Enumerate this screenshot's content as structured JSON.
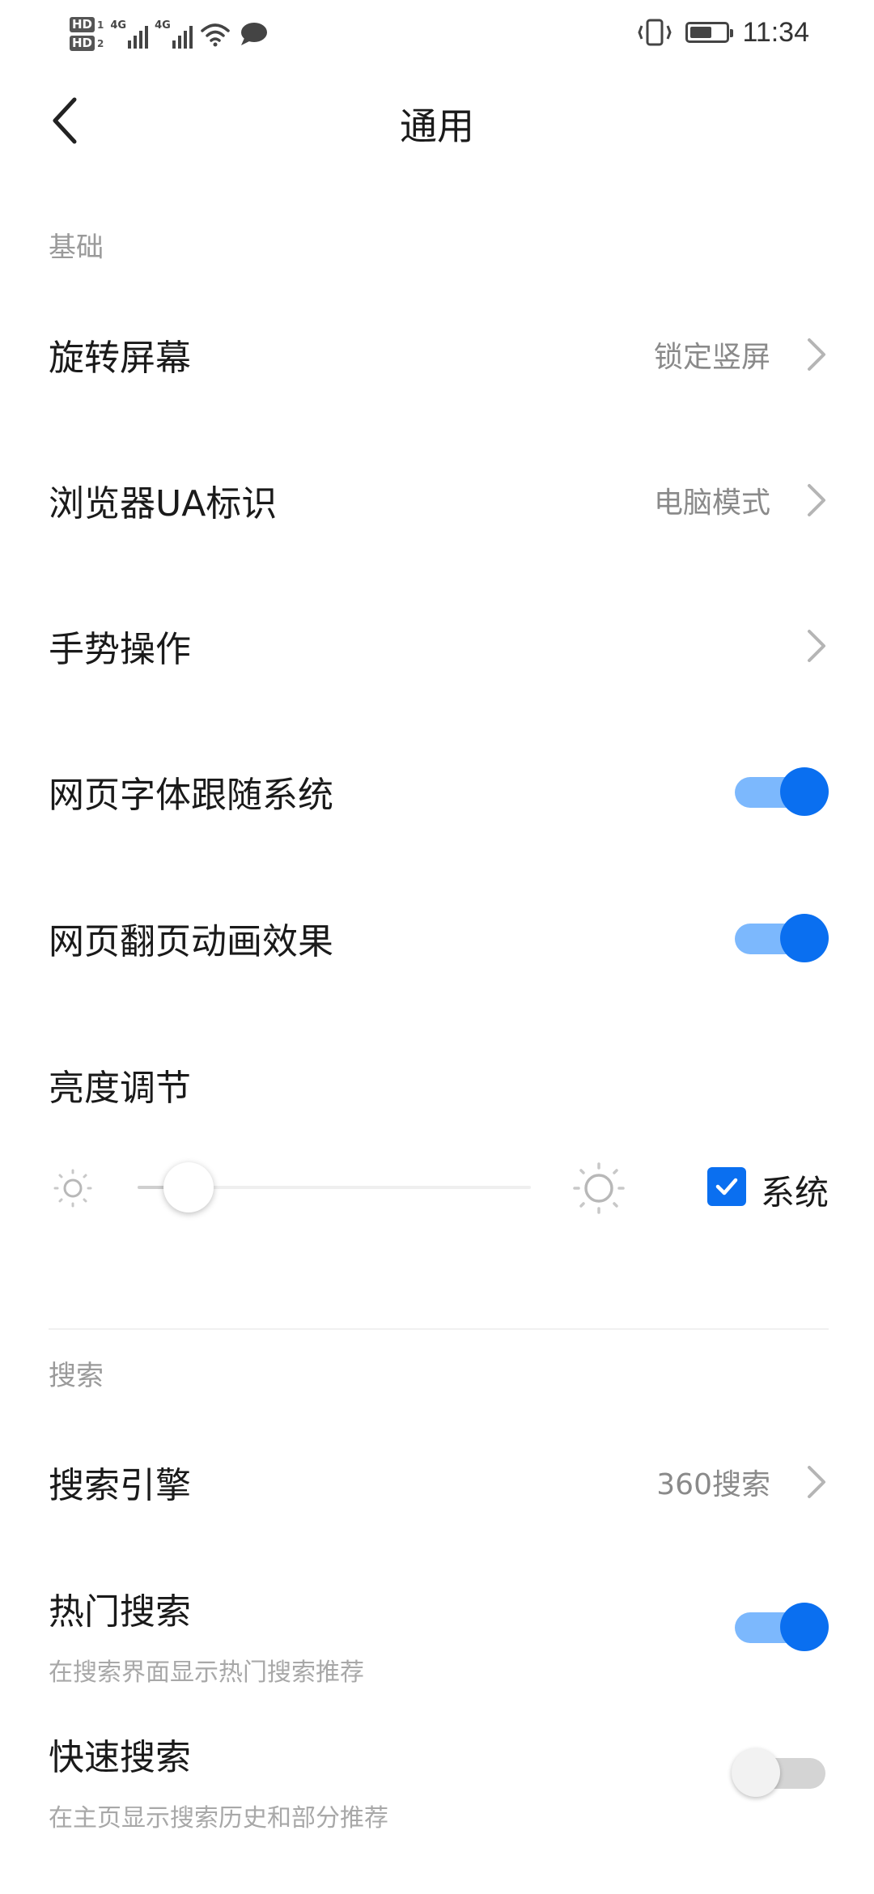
{
  "status_bar": {
    "hd1": "HD",
    "hd1_num": "1",
    "hd2": "HD",
    "hd2_num": "2",
    "net1": "4G",
    "net2": "4G",
    "time": "11:34"
  },
  "header": {
    "title": "通用"
  },
  "sections": {
    "basic_label": "基础",
    "search_label": "搜索"
  },
  "basic": {
    "rotate_title": "旋转屏幕",
    "rotate_value": "锁定竖屏",
    "ua_title": "浏览器UA标识",
    "ua_value": "电脑模式",
    "gesture_title": "手势操作",
    "font_follow_title": "网页字体跟随系统",
    "font_follow_on": true,
    "page_anim_title": "网页翻页动画效果",
    "page_anim_on": true,
    "brightness_title": "亮度调节",
    "brightness_level": 0.13,
    "system_label": "系统",
    "system_checked": true
  },
  "search": {
    "engine_title": "搜索引擎",
    "engine_value": "360搜索",
    "hot_title": "热门搜索",
    "hot_sub": "在搜索界面显示热门搜索推荐",
    "hot_on": true,
    "quick_title": "快速搜索",
    "quick_sub": "在主页显示搜索历史和部分推荐",
    "quick_on": false
  },
  "colors": {
    "accent": "#0a6ff0",
    "accent_light": "#7cb8fd",
    "secondary_text": "#8a8a8a"
  }
}
